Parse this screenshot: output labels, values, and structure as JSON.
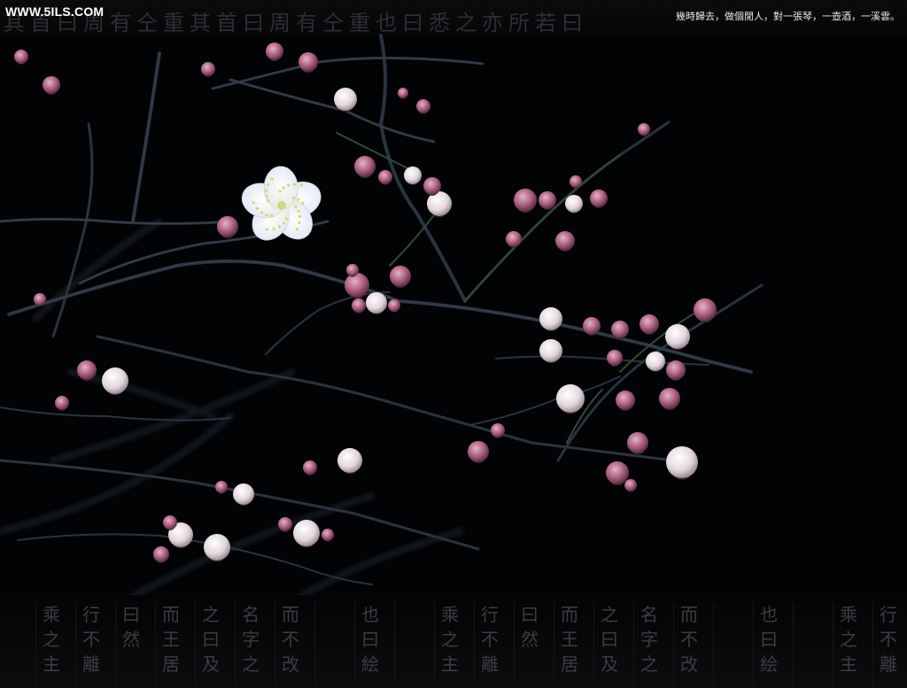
{
  "logo": {
    "text": "WWW.5ILS.COM"
  },
  "poem": {
    "text": "幾時歸去，做個閒人，對一張琴，一壺酒，一溪雲。"
  },
  "top_glyphs": [
    "其",
    "首",
    "曰",
    "周",
    "有",
    "仝",
    "重",
    "其",
    "首",
    "曰",
    "周",
    "有",
    "仝",
    "重",
    "也",
    "曰",
    "悉",
    "之",
    "亦",
    "所",
    "若",
    "曰"
  ],
  "bottom_glyph_columns": [
    [
      "乘",
      "之",
      "主"
    ],
    [
      "行",
      "不",
      "離"
    ],
    [
      "曰",
      "然",
      ""
    ],
    [
      "而",
      "王",
      "居"
    ],
    [
      "之",
      "曰",
      "及"
    ],
    [
      "名",
      "字",
      "之"
    ],
    [
      "而",
      "不",
      "改"
    ],
    [
      "",
      "",
      " "
    ],
    [
      "也",
      "曰",
      "絵"
    ],
    [
      "",
      "",
      " "
    ],
    [
      "乘",
      "之",
      "主"
    ],
    [
      "行",
      "不",
      "離"
    ],
    [
      "曰",
      "然",
      ""
    ],
    [
      "而",
      "王",
      "居"
    ],
    [
      "之",
      "曰",
      "及"
    ],
    [
      "名",
      "字",
      "之"
    ],
    [
      "而",
      "不",
      "改"
    ],
    [
      "",
      "",
      " "
    ],
    [
      "也",
      "曰",
      "絵"
    ],
    [
      "",
      "",
      " "
    ],
    [
      "乘",
      "之",
      "主"
    ],
    [
      "行",
      "不",
      "離"
    ]
  ],
  "colors": {
    "background": "#020304",
    "branch": "#2a3340",
    "branch_highlight": "#3d4a58",
    "stem_green": "#2f4a35",
    "bud_pink": "#b06a86",
    "bud_white": "#e6dde2",
    "blossom": "#f4f6fb",
    "stamen": "#d8d66a"
  }
}
